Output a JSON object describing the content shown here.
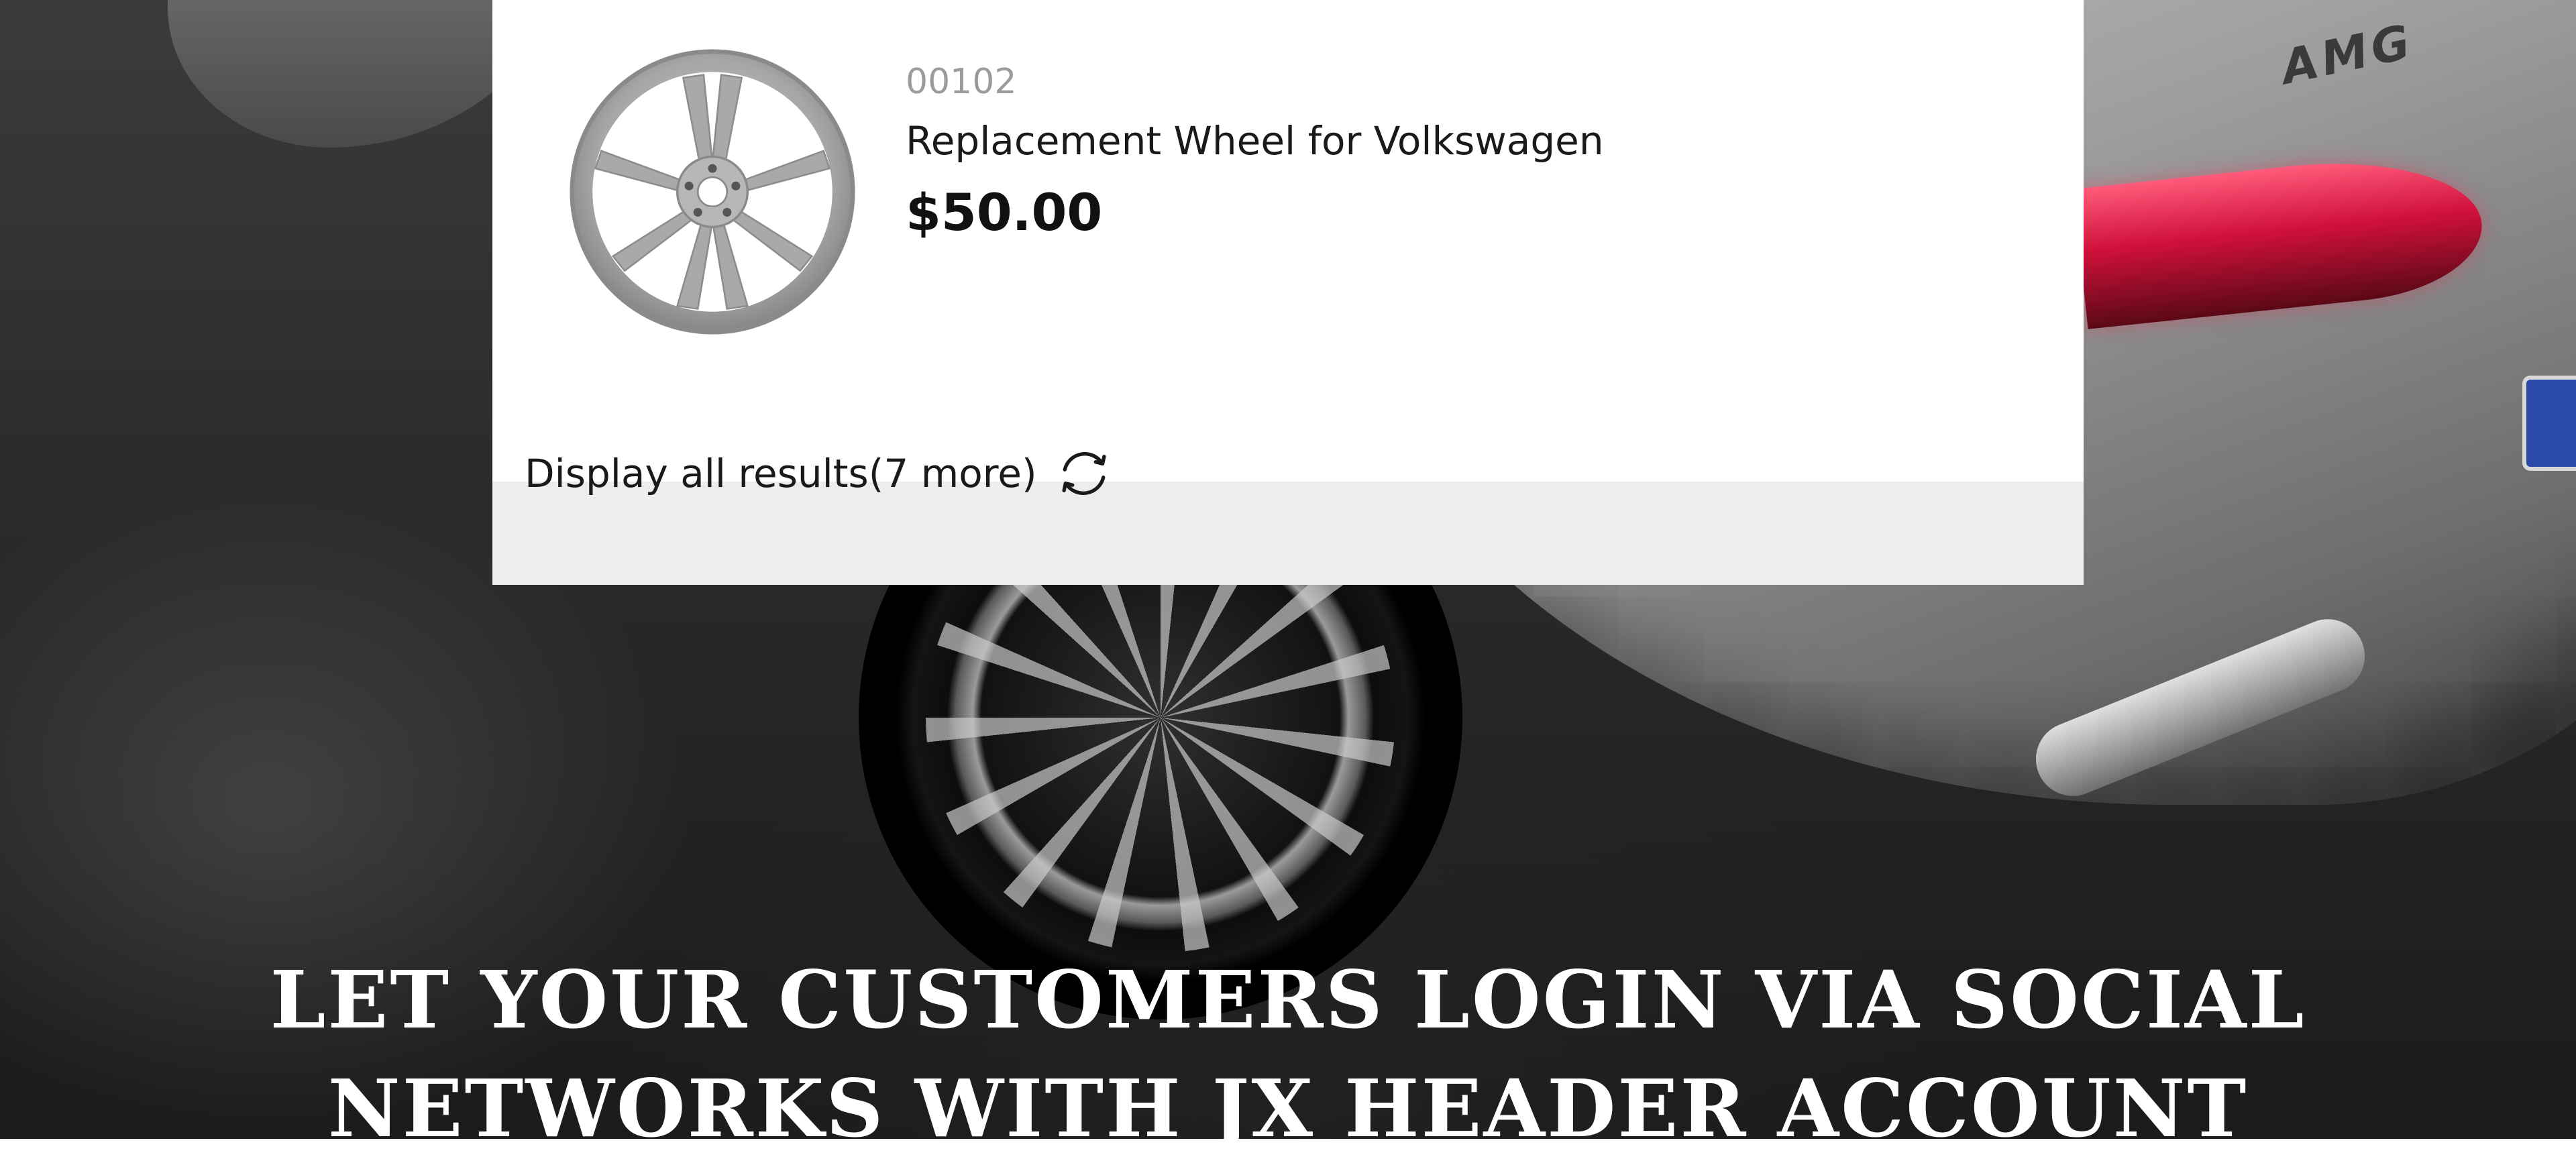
{
  "search_result": {
    "reference": "00102",
    "name": "Replacement Wheel for Volkswagen",
    "price": "$50.00",
    "image_icon": "wheel-icon"
  },
  "display_all": {
    "label": "Display all results(7 more)",
    "icon": "refresh-icon"
  },
  "hero": {
    "badge": "AMG",
    "headline_line1": "LET YOUR CUSTOMERS LOGIN VIA SOCIAL",
    "headline_line2": "NETWORKS WITH JX HEADER ACCOUNT"
  },
  "colors": {
    "taillight": "#d0103a",
    "panel_background": "#ffffff",
    "footer_bar": "#ededed"
  }
}
